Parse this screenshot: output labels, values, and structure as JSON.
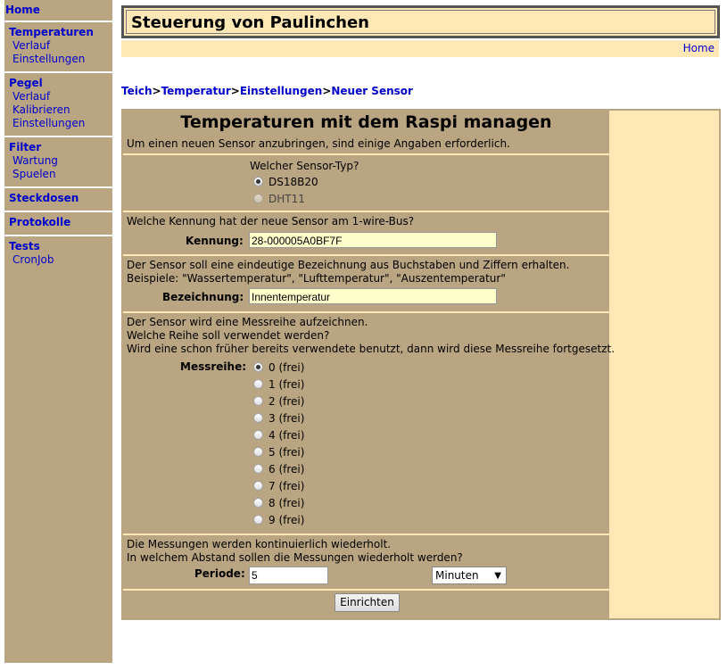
{
  "sidebar": {
    "home": "Home",
    "groups": [
      {
        "title": "Temperaturen",
        "items": [
          "Verlauf",
          "Einstellungen"
        ]
      },
      {
        "title": "Pegel",
        "items": [
          "Verlauf",
          "Kalibrieren",
          "Einstellungen"
        ]
      },
      {
        "title": "Filter",
        "items": [
          "Wartung",
          "Spuelen"
        ]
      },
      {
        "title": "Steckdosen",
        "items": []
      },
      {
        "title": "Protokolle",
        "items": []
      },
      {
        "title": "Tests",
        "items": [
          "CronJob"
        ]
      }
    ]
  },
  "header": {
    "title": "Steuerung von Paulinchen",
    "home_link": "Home"
  },
  "breadcrumb": [
    "Teich",
    "Temperatur",
    "Einstellungen",
    "Neuer Sensor"
  ],
  "breadcrumb_sep": ">",
  "form": {
    "title": "Temperaturen mit dem Raspi managen",
    "intro": "Um einen neuen Sensor anzubringen, sind einige Angaben erforderlich.",
    "sensor_type": {
      "question": "Welcher Sensor-Typ?",
      "options": [
        {
          "label": "DS18B20",
          "checked": true,
          "disabled": false
        },
        {
          "label": "DHT11",
          "checked": false,
          "disabled": true
        }
      ]
    },
    "kennung": {
      "question": "Welche Kennung hat der neue Sensor am 1-wire-Bus?",
      "label": "Kennung:",
      "value": "28-000005A0BF7F"
    },
    "bezeichnung": {
      "text1": "Der Sensor soll eine eindeutige Bezeichnung aus Buchstaben und Ziffern erhalten.",
      "text2": "Beispiele: \"Wassertemperatur\", \"Lufttemperatur\", \"Auszentemperatur\"",
      "label": "Bezeichnung:",
      "value": "Innentemperatur"
    },
    "messreihe": {
      "text1": "Der Sensor wird eine Messreihe aufzeichnen.",
      "text2": "Welche Reihe soll verwendet werden?",
      "text3": "Wird eine schon früher bereits verwendete benutzt, dann wird diese Messreihe fortgesetzt.",
      "label": "Messreihe:",
      "options": [
        "0 (frei)",
        "1 (frei)",
        "2 (frei)",
        "3 (frei)",
        "4 (frei)",
        "5 (frei)",
        "6 (frei)",
        "7 (frei)",
        "8 (frei)",
        "9 (frei)"
      ],
      "selected_index": 0
    },
    "periode": {
      "text1": "Die Messungen werden kontinuierlich wiederholt.",
      "text2": "In welchem Abstand sollen die Messungen wiederholt werden?",
      "label": "Periode:",
      "value": "5",
      "unit": "Minuten"
    },
    "submit_label": "Einrichten"
  },
  "colors": {
    "sidebar_bg": "#b9a582",
    "panel_bg": "#ffe8b6",
    "link": "#0000cc",
    "input_bg": "#ffffcc"
  }
}
